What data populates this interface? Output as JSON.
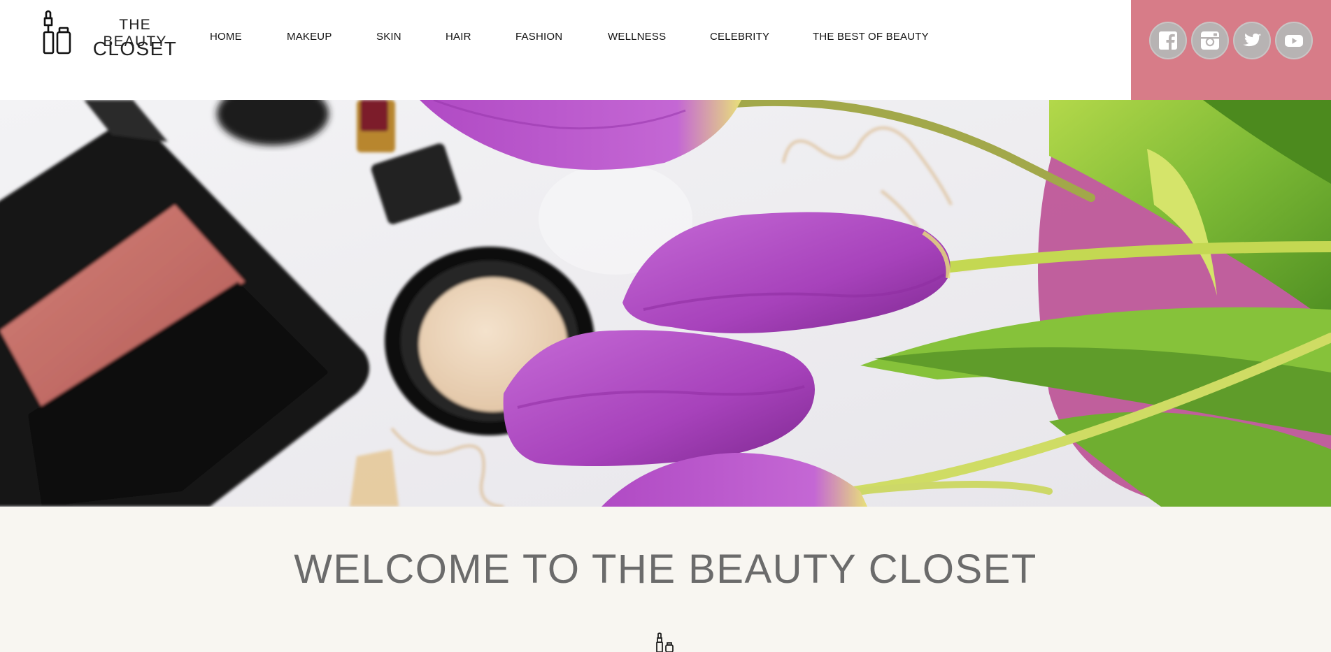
{
  "brand": {
    "line1": "THE BEAUTY",
    "line2": "CLOSET",
    "icon": "lipstick-compact-icon"
  },
  "nav": {
    "items": [
      {
        "label": "HOME"
      },
      {
        "label": "MAKEUP"
      },
      {
        "label": "SKIN"
      },
      {
        "label": "HAIR"
      },
      {
        "label": "FASHION"
      },
      {
        "label": "WELLNESS"
      },
      {
        "label": "CELEBRITY"
      },
      {
        "label": "THE BEST OF BEAUTY"
      }
    ]
  },
  "social": {
    "panel_color": "#d77c88",
    "icons": [
      "facebook-icon",
      "instagram-icon",
      "twitter-icon",
      "youtube-icon"
    ]
  },
  "hero": {
    "image": "makeup-compacts-and-purple-tulips-photo"
  },
  "welcome": {
    "title": "WELCOME TO THE BEAUTY CLOSET",
    "icon": "lipstick-compact-icon"
  },
  "colors": {
    "accent": "#d77c88",
    "page_background": "#f8f6f1",
    "title_text": "#6b6b6b",
    "tulip": "#b24fc4",
    "leaf": "#8cc63f"
  }
}
